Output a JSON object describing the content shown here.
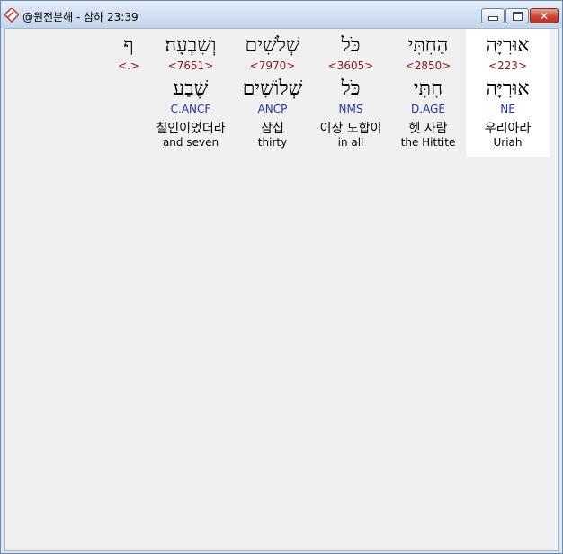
{
  "window": {
    "title": "@원전분해 - 삼하 23:39",
    "buttons": {
      "minimize": "minimize-icon",
      "maximize": "maximize-icon",
      "close": "close-icon"
    }
  },
  "words": [
    {
      "hebrew": "אוּרִיָּה",
      "strongs": "<223>",
      "lemma": "אוּרִיָּה",
      "parse": "NE",
      "korean": "우리아라",
      "english": "Uriah",
      "selected": true
    },
    {
      "hebrew": "הַחִתִּי",
      "strongs": "<2850>",
      "lemma": "חִתִּי",
      "parse": "D.AGE",
      "korean": "헷 사람",
      "english": "the Hittite",
      "selected": false
    },
    {
      "hebrew": "כֹּל",
      "strongs": "<3605>",
      "lemma": "כֹּל",
      "parse": "NMS",
      "korean": "이상 도합이",
      "english": "in all",
      "selected": false
    },
    {
      "hebrew": "שְׁלֹשִׁים",
      "strongs": "<7970>",
      "lemma": "שְׁלוֹשִׁים",
      "parse": "ANCP",
      "korean": "삼십",
      "english": "thirty",
      "selected": false
    },
    {
      "hebrew": "וְשִׁבְעָה׃",
      "strongs": "<7651>",
      "lemma": "שֶׁבַע",
      "parse": "C.ANCF",
      "korean": "칠인이었더라",
      "english": "and seven",
      "selected": false
    },
    {
      "hebrew": "ף",
      "strongs": "<.>",
      "lemma": "",
      "parse": "",
      "korean": "",
      "english": "",
      "selected": false
    }
  ],
  "colors": {
    "strongs": "#8b1a1a",
    "parse": "#2233aa",
    "selected_bg": "#ffffff"
  }
}
